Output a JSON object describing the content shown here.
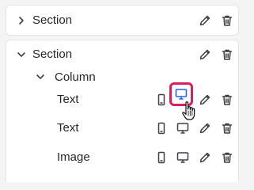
{
  "section_collapsed": {
    "label": "Section",
    "icons": [
      "chevron-right-icon",
      "pencil-icon",
      "trash-icon"
    ]
  },
  "section_expanded": {
    "label": "Section",
    "column": {
      "label": "Column",
      "items": [
        {
          "label": "Text",
          "icons": [
            "mobile-icon",
            "desktop-icon",
            "pencil-icon",
            "trash-icon"
          ],
          "active_icon": "desktop-icon"
        },
        {
          "label": "Text",
          "icons": [
            "mobile-icon",
            "desktop-icon",
            "pencil-icon",
            "trash-icon"
          ]
        },
        {
          "label": "Image",
          "icons": [
            "mobile-icon",
            "desktop-icon",
            "pencil-icon",
            "trash-icon"
          ]
        }
      ]
    }
  },
  "colors": {
    "accent": "#2563eb",
    "highlight": "#d81e5b",
    "icon": "#3f3f46"
  }
}
